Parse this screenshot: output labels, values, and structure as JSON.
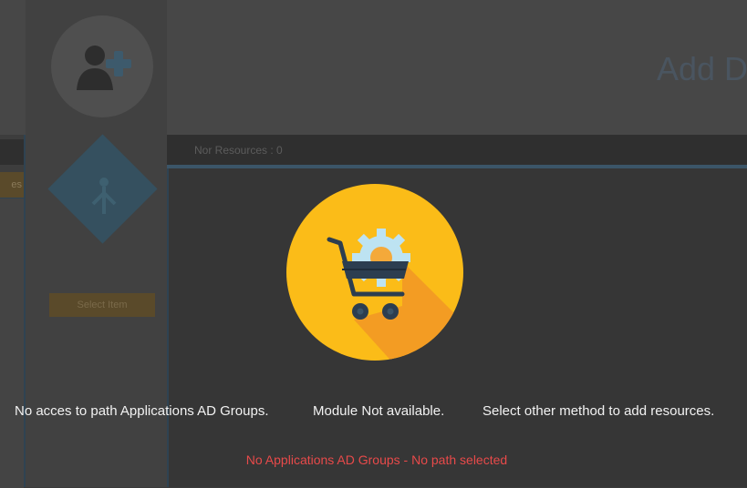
{
  "header": {
    "title_fragment": "Add D"
  },
  "sidebar": {
    "tab_fragment": "es",
    "select_button_label": "Select Item"
  },
  "resources_bar": {
    "label": "Nor Resources : 0"
  },
  "overlay": {
    "message_parts": [
      "No acces to path Applications AD Groups.",
      "Module Not available.",
      "Select other method to add resources."
    ],
    "error_message": "No Applications AD Groups - No path selected",
    "icon": "shopping-cart-gear-icon"
  },
  "colors": {
    "icon_circle": "#fbbc18",
    "icon_shadow": "#f39c23",
    "cart": "#2c3e50",
    "gear": "#bde3f2",
    "error": "#e84a4a",
    "message": "#f2f2f2"
  }
}
